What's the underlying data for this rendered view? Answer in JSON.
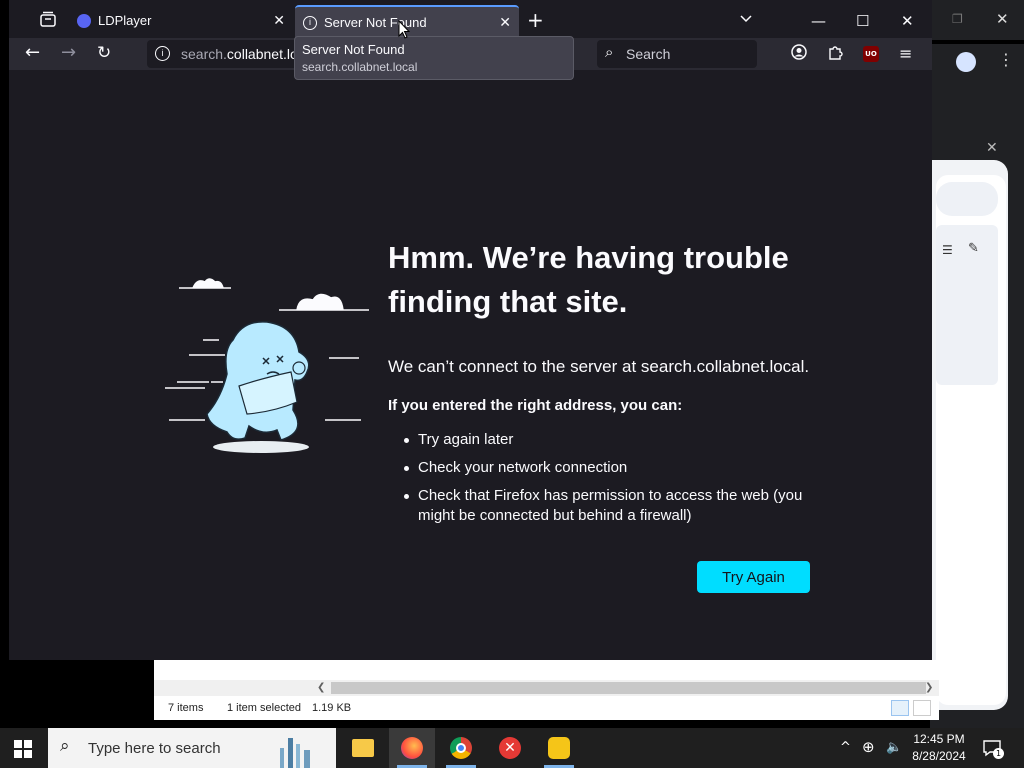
{
  "browser": {
    "tabs": [
      {
        "title": "LDPlayer",
        "favicon": "discord-icon",
        "active": false
      },
      {
        "title": "Server Not Found",
        "favicon": "info-icon",
        "active": true
      }
    ],
    "url": {
      "host_dim": "search.",
      "host_main": "collabnet.loc"
    },
    "search_placeholder": "Search",
    "tooltip": {
      "title": "Server Not Found",
      "url": "search.collabnet.local"
    },
    "ublock_label": "UO"
  },
  "error_page": {
    "heading": "Hmm. We’re having trouble finding that site.",
    "message": "We can’t connect to the server at search.collabnet.local.",
    "list_title": "If you entered the right address, you can:",
    "suggestions": [
      "Try again later",
      "Check your network connection",
      "Check that Firefox has permission to access the web (you might be connected but behind a firewall)"
    ],
    "try_again_label": "Try Again"
  },
  "explorer": {
    "items_count": "7 items",
    "selection": "1 item selected",
    "size": "1.19 KB"
  },
  "taskbar": {
    "search_placeholder": "Type here to search",
    "time": "12:45 PM",
    "date": "8/28/2024",
    "notification_count": "1"
  },
  "colors": {
    "accent_button": "#00ddff",
    "page_background": "#1c1b22",
    "active_tab_indicator": "#5a9cff"
  }
}
